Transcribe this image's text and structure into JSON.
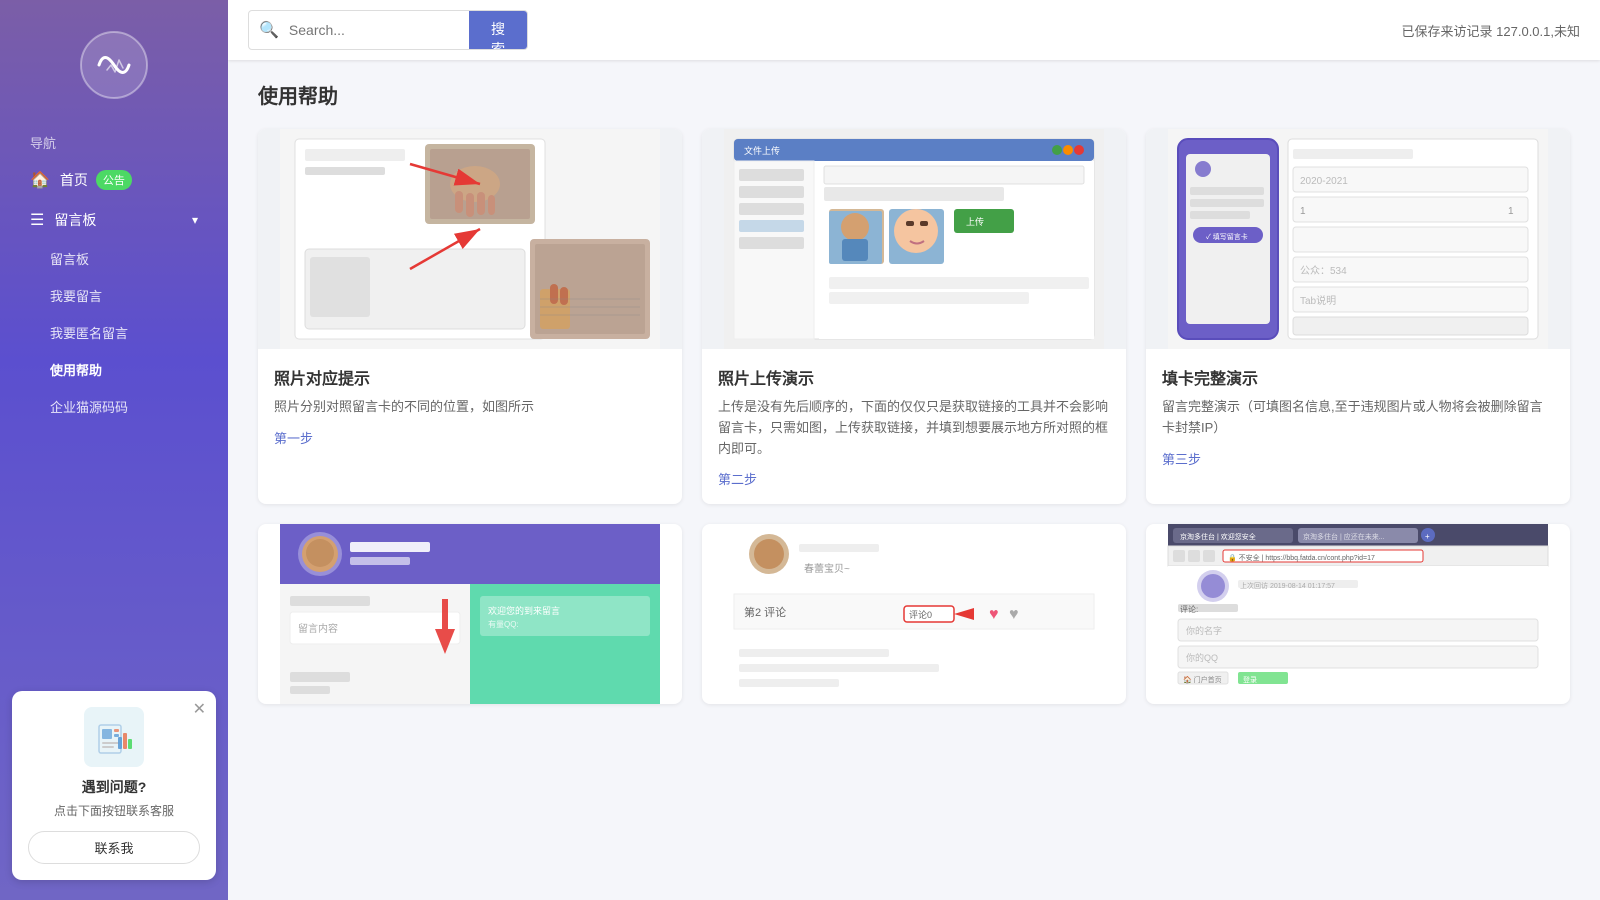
{
  "sidebar": {
    "logo_alt": "HeartRate Logo",
    "nav_label": "导航",
    "items": [
      {
        "id": "home",
        "label": "首页",
        "icon": "🏠",
        "badge": "公告",
        "has_badge": true
      },
      {
        "id": "message-board",
        "label": "留言板",
        "icon": "💬",
        "has_arrow": true,
        "expanded": true
      },
      {
        "id": "message-board-sub",
        "label": "留言板",
        "is_sub": true
      },
      {
        "id": "my-message",
        "label": "我要留言",
        "is_sub": true
      },
      {
        "id": "anonymous-message",
        "label": "我要匿名留言",
        "is_sub": true
      },
      {
        "id": "help",
        "label": "使用帮助",
        "is_sub": true,
        "active": true
      },
      {
        "id": "enterprise",
        "label": "企业猫源码码",
        "is_sub": true
      }
    ]
  },
  "help_widget": {
    "title": "遇到问题?",
    "subtitle": "点击下面按钮联系客服",
    "contact_label": "联系我"
  },
  "header": {
    "search_placeholder": "Search...",
    "search_button_label": "搜索",
    "status_text": "已保存来访记录 127.0.0.1,未知"
  },
  "page": {
    "title": "使用帮助",
    "cards": [
      {
        "id": "card1",
        "title": "照片对应提示",
        "desc": "照片分别对照留言卡的不同的位置，如图所示",
        "step": "第一步"
      },
      {
        "id": "card2",
        "title": "照片上传演示",
        "desc": "上传是没有先后顺序的，下面的仅仅只是获取链接的工具并不会影响留言卡，只需如图，上传获取链接，并填到想要展示地方所对照的框内即可。",
        "step": "第二步"
      },
      {
        "id": "card3",
        "title": "填卡完整演示",
        "desc": "留言完整演示（可填图名信息,至于违规图片或人物将会被删除留言卡封禁IP）",
        "step": "第三步"
      }
    ],
    "bottom_cards": [
      {
        "id": "bc1"
      },
      {
        "id": "bc2"
      },
      {
        "id": "bc3"
      }
    ]
  }
}
